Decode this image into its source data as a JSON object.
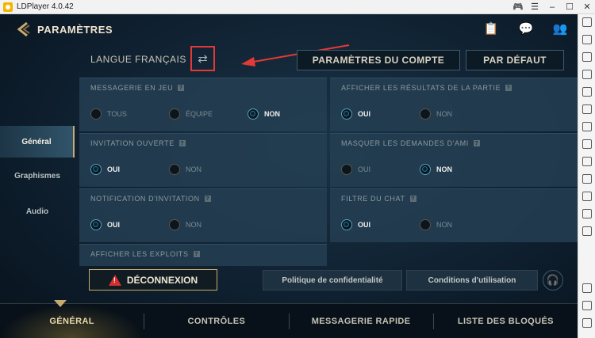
{
  "emulator": {
    "title": "LDPlayer 4.0.42",
    "controls": [
      "gamepad-icon",
      "menu-icon",
      "minimize-icon",
      "maximize-icon",
      "close-icon"
    ]
  },
  "header": {
    "title": "PARAMÈTRES",
    "icons": [
      "clipboard-icon",
      "chat-icon",
      "friends-icon"
    ]
  },
  "language": {
    "label": "LANGUE FRANÇAIS"
  },
  "buttons": {
    "account": "PARAMÈTRES DU COMPTE",
    "default": "PAR DÉFAUT",
    "logout": "DÉCONNEXION",
    "privacy": "Politique de confidentialité",
    "terms": "Conditions d'utilisation"
  },
  "side_tabs": [
    {
      "label": "Général",
      "active": true
    },
    {
      "label": "Graphismes",
      "active": false
    },
    {
      "label": "Audio",
      "active": false
    }
  ],
  "settings": {
    "ingame_messaging": {
      "title": "MESSAGERIE EN JEU",
      "options": [
        "TOUS",
        "ÉQUIPE",
        "NON"
      ],
      "selected": "NON"
    },
    "show_results": {
      "title": "AFFICHER LES RÉSULTATS DE LA PARTIE",
      "options": [
        "OUI",
        "NON"
      ],
      "selected": "OUI"
    },
    "open_invite": {
      "title": "INVITATION OUVERTE",
      "options": [
        "OUI",
        "NON"
      ],
      "selected": "OUI"
    },
    "hide_friend_requests": {
      "title": "MASQUER LES DEMANDES D'AMI",
      "options": [
        "OUI",
        "NON"
      ],
      "selected": "NON"
    },
    "invite_notification": {
      "title": "NOTIFICATION D'INVITATION",
      "options": [
        "OUI",
        "NON"
      ],
      "selected": "OUI"
    },
    "chat_filter": {
      "title": "FILTRE DU CHAT",
      "options": [
        "OUI",
        "NON"
      ],
      "selected": "OUI"
    },
    "show_achievements": {
      "title": "AFFICHER LES EXPLOITS"
    }
  },
  "help_glyph": "?",
  "bottom_nav": [
    {
      "label": "GÉNÉRAL",
      "active": true
    },
    {
      "label": "CONTRÔLES",
      "active": false
    },
    {
      "label": "MESSAGERIE RAPIDE",
      "active": false
    },
    {
      "label": "LISTE DES BLOQUÉS",
      "active": false
    }
  ],
  "colors": {
    "accent_gold": "#c8aa6e",
    "radio_selected": "#4fa3c7",
    "annotation_red": "#e53935",
    "danger": "#d32f2f"
  }
}
